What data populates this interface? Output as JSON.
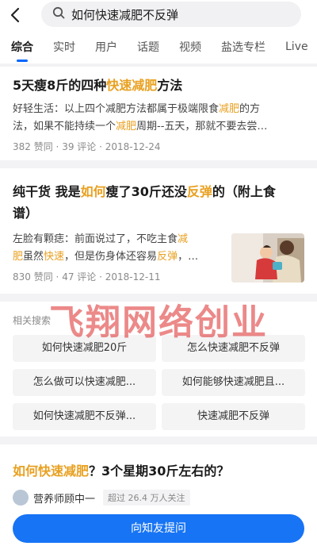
{
  "search": {
    "query": "如何快速减肥不反弹"
  },
  "tabs": [
    {
      "label": "综合",
      "active": true
    },
    {
      "label": "实时"
    },
    {
      "label": "用户"
    },
    {
      "label": "话题"
    },
    {
      "label": "视频"
    },
    {
      "label": "盐选专栏"
    },
    {
      "label": "Live"
    }
  ],
  "results": [
    {
      "title_parts": [
        "5天瘦8斤的四种",
        "快速减肥",
        "方法"
      ],
      "excerpt_line1_parts": [
        "好轻生活：以上四个减肥方法都属于极端限食",
        "减肥",
        "的方"
      ],
      "excerpt_line2_parts": [
        "法，如果不能持续一个",
        "减肥",
        "周期--五天，那就不要去尝…"
      ],
      "likes": "382 赞同",
      "comments": "39 评论",
      "date": "2018-12-24"
    },
    {
      "title_line1_parts": [
        "纯干货 我是",
        "如何",
        "瘦了30斤还没",
        "反弹",
        "的（附上食"
      ],
      "title_line2": "谱）",
      "excerpt_line1_parts": [
        "左脸有颗痣：前面说过了，不吃主食",
        "减"
      ],
      "excerpt_line2_parts": [
        "肥",
        "虽然",
        "快速",
        "，但是伤身体还容易",
        "反弹",
        "，…"
      ],
      "likes": "830 赞同",
      "comments": "47 评论",
      "date": "2018-12-11"
    }
  ],
  "related": {
    "title": "相关搜索",
    "items": [
      "如何快速减肥20斤",
      "怎么快速减肥不反弹",
      "怎么做可以快速减肥...",
      "如何能够快速减肥且...",
      "如何快速减肥不反弹...",
      "快速减肥不反弹"
    ]
  },
  "watermark": "飞翔网络创业",
  "question": {
    "title_parts": [
      "如何快速减肥",
      "？3个星期30斤左右的？"
    ],
    "author": "营养师顾中一",
    "followers": "超过 26.4 万人关注"
  },
  "ask_button": "向知友提问",
  "colors": {
    "highlight": "#e8a020",
    "accent": "#1774f4",
    "watermark": "#dc2828"
  }
}
